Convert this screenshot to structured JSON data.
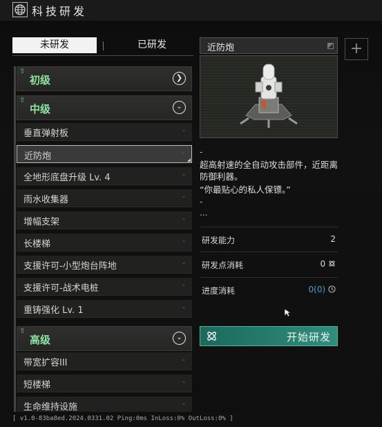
{
  "window": {
    "title": "科技研发"
  },
  "tabs": {
    "active": "未研发",
    "inactive": "已研发"
  },
  "list": {
    "categories": {
      "basic": {
        "label": "初级"
      },
      "intermediate": {
        "label": "中级"
      },
      "advanced": {
        "label": "高级"
      }
    },
    "intermediate_items": [
      {
        "label": "垂直弹射板",
        "dash": "-"
      },
      {
        "label": "近防炮",
        "dash": "-"
      },
      {
        "label": "全地形底盘升级 Lv. 4",
        "dash": "-"
      },
      {
        "label": "雨水收集器",
        "dash": "-"
      },
      {
        "label": "增幅支架",
        "dash": "-"
      },
      {
        "label": "长楼梯",
        "dash": "-"
      },
      {
        "label": "支援许可-小型炮台阵地",
        "dash": "-"
      },
      {
        "label": "支援许可-战术电桩",
        "dash": "-"
      },
      {
        "label": "重铸强化 Lv. 1",
        "dash": "-"
      }
    ],
    "advanced_items": [
      {
        "label": "带宽扩容III",
        "dash": "-"
      },
      {
        "label": "短楼梯",
        "dash": "-"
      },
      {
        "label": "生命维持设施",
        "dash": "-"
      }
    ]
  },
  "detail": {
    "title": "近防炮",
    "dash1": "-",
    "description": "超高射速的全自动攻击部件，近距离防御利器。",
    "quote": "“你最贴心的私人保镖。”",
    "dash2": "-",
    "dots": "...",
    "stats": [
      {
        "label": "研发能力",
        "value": "2"
      },
      {
        "label": "研发点消耗",
        "value": "0"
      },
      {
        "label": "进度消耗",
        "value": "0",
        "value_accent": "(0)"
      }
    ],
    "start_button": "开始研发"
  },
  "status_bar": "[ v1.0-83ba8ed.2024.0331.02  Ping:0ms  InLoss:0%  OutLoss:0% ]",
  "colors": {
    "accent_green": "#8fe39f",
    "button_teal": "#2f8e7b",
    "accent_blue": "#3fa3c9"
  }
}
